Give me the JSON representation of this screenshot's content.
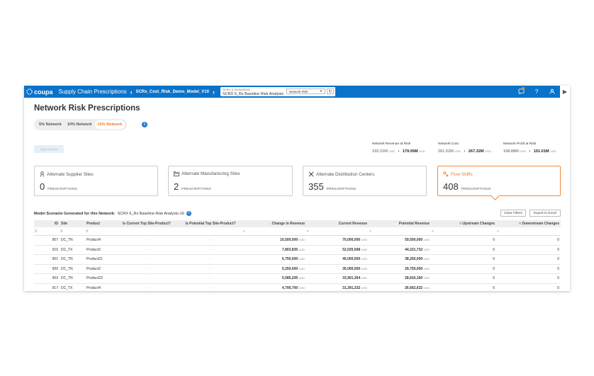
{
  "topbar": {
    "logo_text": "coupa",
    "app_title": "Supply Chain Prescriptions",
    "model_name": "SCRx_Cost_Risk_Demo_Model_V10",
    "scenario_small": "SCRx_6_Rx 8025218",
    "scenario_name": "SCRX 6_Rx Baseline Risk Analysis",
    "analysis_select": "Network Risk",
    "accent_color": "#0a73c9",
    "icons": [
      "notifications-icon",
      "help-icon",
      "user-icon",
      "play-icon"
    ]
  },
  "page": {
    "title": "Network Risk Prescriptions",
    "segments": [
      "5% Network",
      "10% Network",
      "15% Network"
    ],
    "active_segment": "15% Network",
    "apply_button": "Apply Network"
  },
  "metrics": [
    {
      "label": "Network Revenue at Risk",
      "current": "192.21M",
      "current_unit": "USD",
      "potential": "179.05M",
      "potential_unit": "USD"
    },
    {
      "label": "Network Cost",
      "current": "261.52M",
      "current_unit": "USD",
      "potential": "267.32M",
      "potential_unit": "USD"
    },
    {
      "label": "Network Profit at Risk",
      "current": "168.88M",
      "current_unit": "USD",
      "potential": "151.01M",
      "potential_unit": "USD"
    }
  ],
  "cards": [
    {
      "title": "Alternate Supplier Sites",
      "value": "0",
      "unit": "PRESCRIPTIONS"
    },
    {
      "title": "Alternate Manufacturing Sites",
      "value": "2",
      "unit": "PRESCRIPTIONS"
    },
    {
      "title": "Alternate Distribution Centers",
      "value": "355",
      "unit": "PRESCRIPTIONS"
    },
    {
      "title": "Flow Shifts",
      "value": "408",
      "unit": "PRESCRIPTIONS"
    }
  ],
  "scenario_line": {
    "label": "Model Scenario Generated for this Network:",
    "value": "SCRX 6_Rx Baseline Risk Analysis-16"
  },
  "buttons": {
    "clear_filters": "Clear Filters",
    "export": "Export to Excel"
  },
  "table": {
    "columns": [
      "ID",
      "Site",
      "Product",
      "Is Current Top Site-Product?",
      "Is Potential Top Site-Product?",
      "↓ Change in Revenue",
      "Current Revenue",
      "Potential Revenue",
      "≈ Upstream Changes",
      "≈ Downstream Changes"
    ],
    "currency": "USD",
    "rows": [
      {
        "id": "907",
        "site": "DC_TN",
        "product": "Product4",
        "change": "10,500,000",
        "current": "70,000,000",
        "potential": "59,500,000",
        "up": "0",
        "down": "0"
      },
      {
        "id": "910",
        "site": "DC_TX",
        "product": "Product2",
        "change": "7,803,835",
        "current": "52,025,568",
        "potential": "44,221,732",
        "up": "0",
        "down": "0"
      },
      {
        "id": "901",
        "site": "DC_TN",
        "product": "Product21",
        "change": "6,750,000",
        "current": "45,000,000",
        "potential": "38,250,000",
        "up": "0",
        "down": "0"
      },
      {
        "id": "900",
        "site": "DC_TN",
        "product": "Product2",
        "change": "5,250,000",
        "current": "35,000,000",
        "potential": "29,750,000",
        "up": "0",
        "down": "0"
      },
      {
        "id": "903",
        "site": "DC_TN",
        "product": "Product23",
        "change": "5,085,205",
        "current": "33,901,364",
        "potential": "28,816,160",
        "up": "0",
        "down": "0"
      },
      {
        "id": "917",
        "site": "DC_TX",
        "product": "Product4",
        "change": "4,706,700",
        "current": "31,391,332",
        "potential": "26,662,632",
        "up": "0",
        "down": "0"
      }
    ]
  }
}
